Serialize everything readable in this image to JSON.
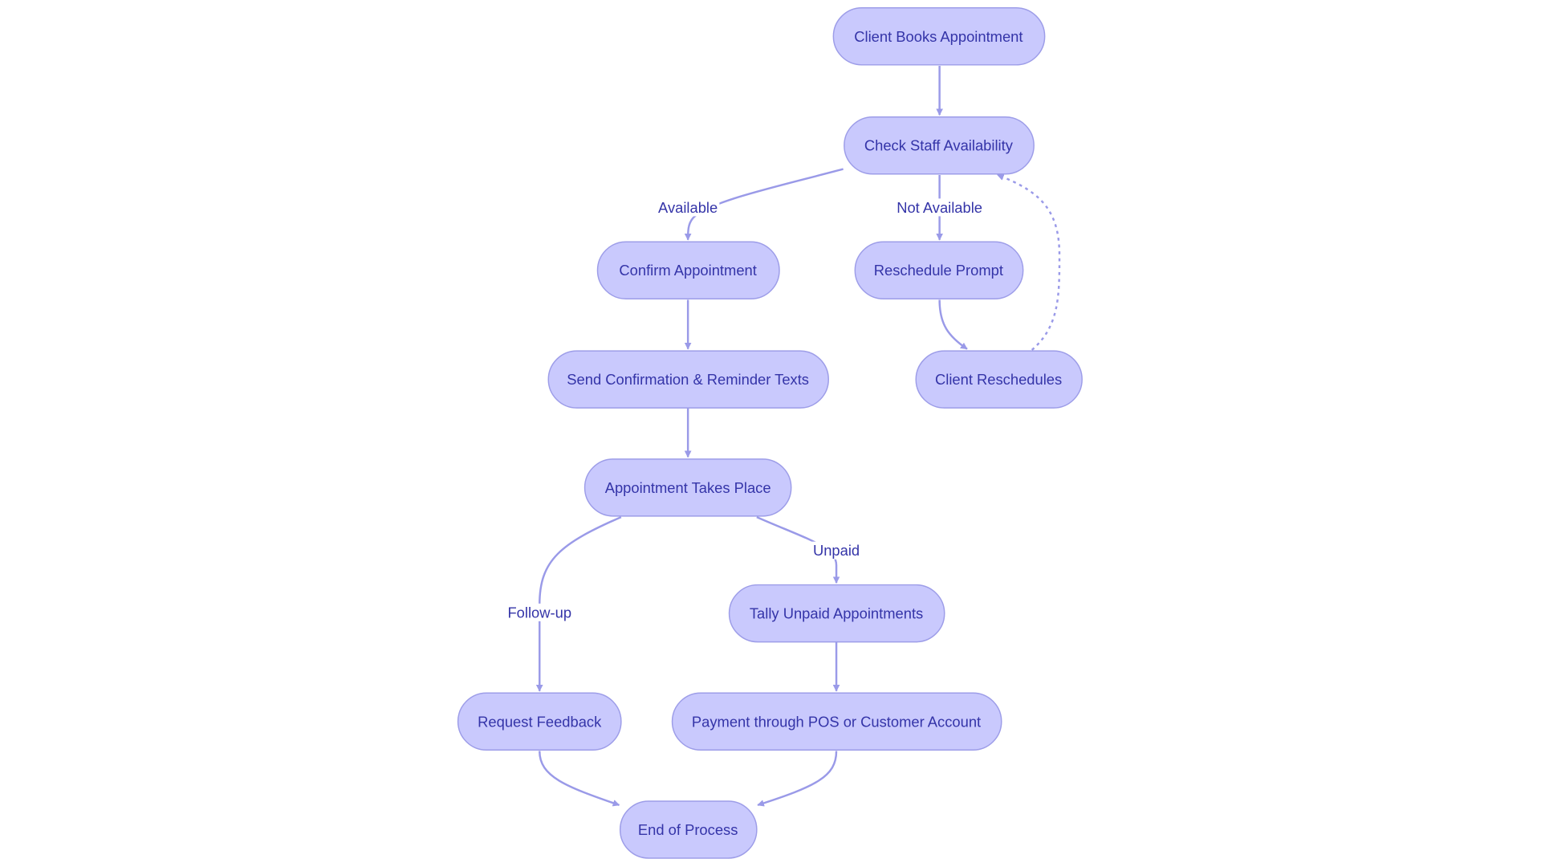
{
  "diagram": {
    "type": "flowchart",
    "colors": {
      "node_fill": "#c9c9fd",
      "node_stroke": "#9d9de8",
      "edge": "#9a9ae8",
      "text": "#3434a8"
    },
    "nodes": {
      "client_books": "Client Books Appointment",
      "check_staff": "Check Staff Availability",
      "confirm": "Confirm Appointment",
      "reschedule_prompt": "Reschedule Prompt",
      "send_texts": "Send Confirmation & Reminder Texts",
      "client_reschedules": "Client Reschedules",
      "takes_place": "Appointment Takes Place",
      "tally_unpaid": "Tally Unpaid Appointments",
      "request_feedback": "Request Feedback",
      "payment": "Payment through POS or Customer Account",
      "end": "End of Process"
    },
    "edge_labels": {
      "available": "Available",
      "not_available": "Not Available",
      "unpaid": "Unpaid",
      "follow_up": "Follow-up"
    },
    "edges": [
      {
        "from": "client_books",
        "to": "check_staff"
      },
      {
        "from": "check_staff",
        "to": "confirm",
        "label": "Available"
      },
      {
        "from": "check_staff",
        "to": "reschedule_prompt",
        "label": "Not Available"
      },
      {
        "from": "reschedule_prompt",
        "to": "client_reschedules"
      },
      {
        "from": "client_reschedules",
        "to": "check_staff",
        "style": "dotted"
      },
      {
        "from": "confirm",
        "to": "send_texts"
      },
      {
        "from": "send_texts",
        "to": "takes_place"
      },
      {
        "from": "takes_place",
        "to": "request_feedback",
        "label": "Follow-up"
      },
      {
        "from": "takes_place",
        "to": "tally_unpaid",
        "label": "Unpaid"
      },
      {
        "from": "tally_unpaid",
        "to": "payment"
      },
      {
        "from": "request_feedback",
        "to": "end"
      },
      {
        "from": "payment",
        "to": "end"
      }
    ]
  }
}
